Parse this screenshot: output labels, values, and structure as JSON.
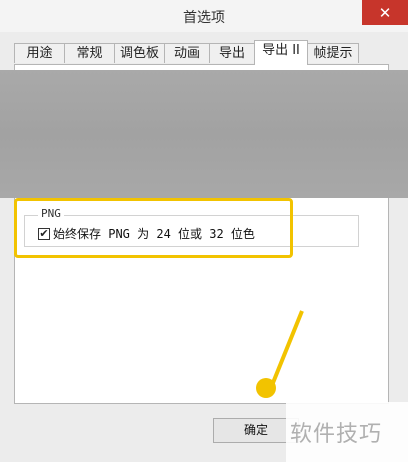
{
  "window": {
    "title": "首选项",
    "close_icon": "close-icon"
  },
  "tabs": [
    {
      "label": "用途"
    },
    {
      "label": "常规"
    },
    {
      "label": "调色板"
    },
    {
      "label": "动画"
    },
    {
      "label": "导出"
    },
    {
      "label": "导出 II",
      "active": true
    },
    {
      "label": "帧提示"
    }
  ],
  "png_group": {
    "legend": "PNG",
    "checkbox_label": "始终保存 PNG 为 24 位或 32 位色",
    "checked": true
  },
  "buttons": {
    "ok": "确定"
  },
  "watermark": "软件技巧",
  "colors": {
    "highlight": "#f2c300",
    "close": "#c7352b"
  }
}
